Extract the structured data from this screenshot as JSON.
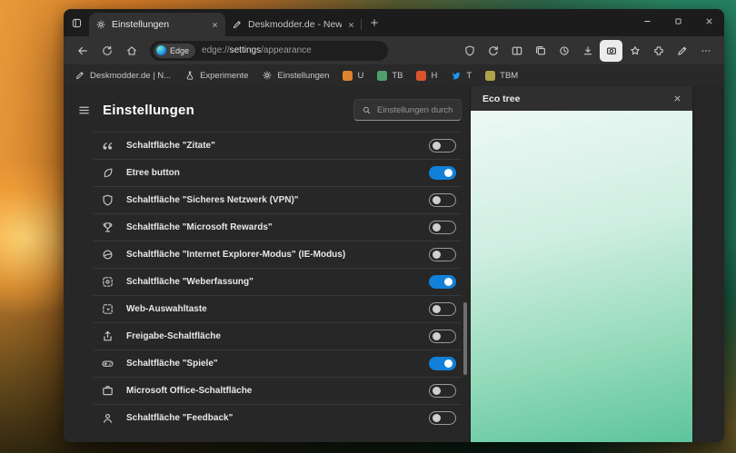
{
  "window": {
    "tabs": [
      {
        "title": "Einstellungen",
        "icon": "gear"
      },
      {
        "title": "Deskmodder.de - News zum Th...",
        "icon": "pen"
      }
    ]
  },
  "toolbar": {
    "site_badge": "Edge",
    "url_scheme": "edge://",
    "url_host": "settings",
    "url_path": "/appearance",
    "nav_icons": [
      "back",
      "refresh",
      "home"
    ],
    "right_icons": [
      "shield",
      "sync",
      "split",
      "collections",
      "history",
      "downloads",
      "screenshot",
      "star",
      "extensions",
      "pen",
      "more"
    ]
  },
  "favorites": [
    {
      "icon": "pen",
      "label": "Deskmodder.de | N..."
    },
    {
      "icon": "flask",
      "label": "Experimente"
    },
    {
      "icon": "gear",
      "label": "Einstellungen"
    },
    {
      "icon": "square",
      "color": "#e0832f",
      "label": "U"
    },
    {
      "icon": "square",
      "color": "#4f9e6b",
      "label": "TB"
    },
    {
      "icon": "square",
      "color": "#d8542c",
      "label": "H"
    },
    {
      "icon": "bird",
      "color": "#1d9bf0",
      "label": "T"
    },
    {
      "icon": "square",
      "color": "#b0a14b",
      "label": "TBM"
    }
  ],
  "settings": {
    "title": "Einstellungen",
    "search_placeholder": "Einstellungen durchsuc...",
    "rows": [
      {
        "icon": "quote",
        "label": "Schaltfläche \"Zitate\"",
        "on": false
      },
      {
        "icon": "leaf",
        "label": "Etree button",
        "on": true
      },
      {
        "icon": "shield",
        "label": "Schaltfläche \"Sicheres Netzwerk (VPN)\"",
        "on": false
      },
      {
        "icon": "trophy",
        "label": "Schaltfläche \"Microsoft Rewards\"",
        "on": false
      },
      {
        "icon": "ie",
        "label": "Schaltfläche \"Internet Explorer-Modus\" (IE-Modus)",
        "on": false
      },
      {
        "icon": "capture",
        "label": "Schaltfläche \"Weberfassung\"",
        "on": true
      },
      {
        "icon": "select",
        "label": "Web-Auswahltaste",
        "on": false
      },
      {
        "icon": "share",
        "label": "Freigabe-Schaltfläche",
        "on": false
      },
      {
        "icon": "gamepad",
        "label": "Schaltfläche \"Spiele\"",
        "on": true
      },
      {
        "icon": "office",
        "label": "Microsoft Office-Schaltfläche",
        "on": false
      },
      {
        "icon": "feedback",
        "label": "Schaltfläche \"Feedback\"",
        "on": false
      }
    ]
  },
  "panel": {
    "title": "Eco tree"
  },
  "colors": {
    "toggle_on": "#1080d8",
    "panel_top": "#edf8f4",
    "panel_bottom": "#5cc49c"
  }
}
